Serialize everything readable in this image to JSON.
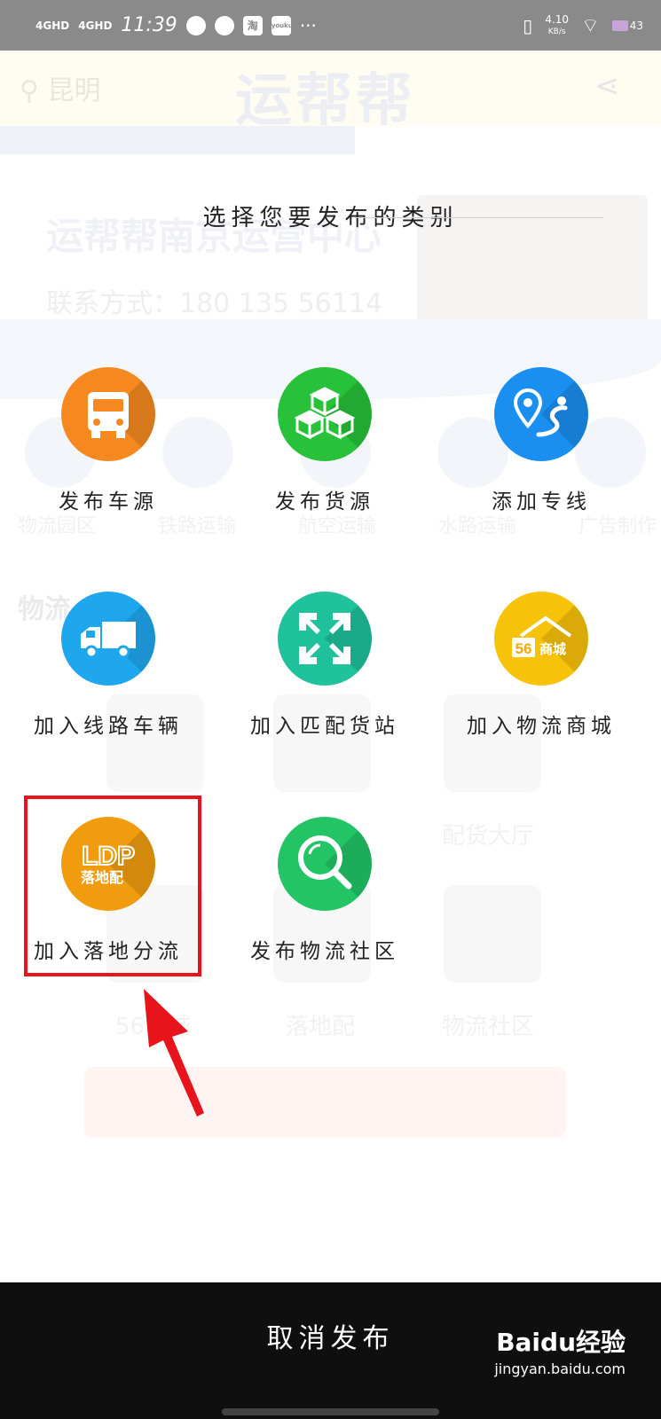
{
  "status_bar": {
    "network1": "4GHD",
    "network2": "4GHD",
    "time": "11:39",
    "app_badge1": "淘",
    "app_badge2": "youku",
    "more": "···",
    "speed": "4.10",
    "speed_unit": "KB/s",
    "battery": "43"
  },
  "background_page": {
    "location": "昆明",
    "logo": "运帮帮",
    "title": "运帮帮南京运营中心",
    "contact": "联系方式：180 135 56114",
    "categories": [
      "物流园区",
      "铁路运输",
      "航空运输",
      "水路运输",
      "广告制作"
    ],
    "news_label": "物流",
    "tiles": [
      "配货大厅",
      "56商城",
      "落地配",
      "物流社区"
    ]
  },
  "modal": {
    "title": "选择您要发布的类别",
    "items": [
      {
        "label": "发布车源",
        "icon": "truck-front-icon",
        "color": "#f5891f"
      },
      {
        "label": "发布货源",
        "icon": "boxes-icon",
        "color": "#27c13a"
      },
      {
        "label": "添加专线",
        "icon": "route-pin-icon",
        "color": "#1a8ff0"
      },
      {
        "label": "加入线路车辆",
        "icon": "truck-side-icon",
        "color": "#1fa7ee"
      },
      {
        "label": "加入匹配货站",
        "icon": "cross-arrows-icon",
        "color": "#1fc29a"
      },
      {
        "label": "加入物流商城",
        "icon": "shop-56-icon",
        "color": "#f7c20a",
        "badge": "56",
        "badge_text": "商城"
      },
      {
        "label": "加入落地分流",
        "icon": "ldp-logo-icon",
        "color": "#f09c0e",
        "logo_text": "LDP",
        "logo_sub": "落地配"
      },
      {
        "label": "发布物流社区",
        "icon": "magnifier-icon",
        "color": "#22c466"
      }
    ],
    "cancel_label": "取消发布"
  },
  "watermark": {
    "brand": "Baidu经验",
    "sub": "jingyan.baidu.com"
  }
}
